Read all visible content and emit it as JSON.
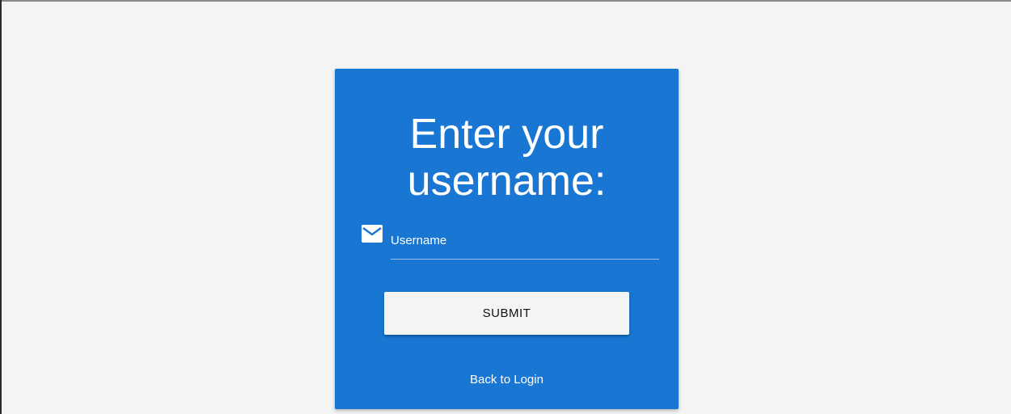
{
  "card": {
    "title": "Enter your username:",
    "background_color": "#1976d2"
  },
  "username_field": {
    "icon": "mail-icon",
    "label": "Username",
    "value": ""
  },
  "submit_button": {
    "label": "SUBMIT"
  },
  "back_link": {
    "label": "Back to Login"
  }
}
